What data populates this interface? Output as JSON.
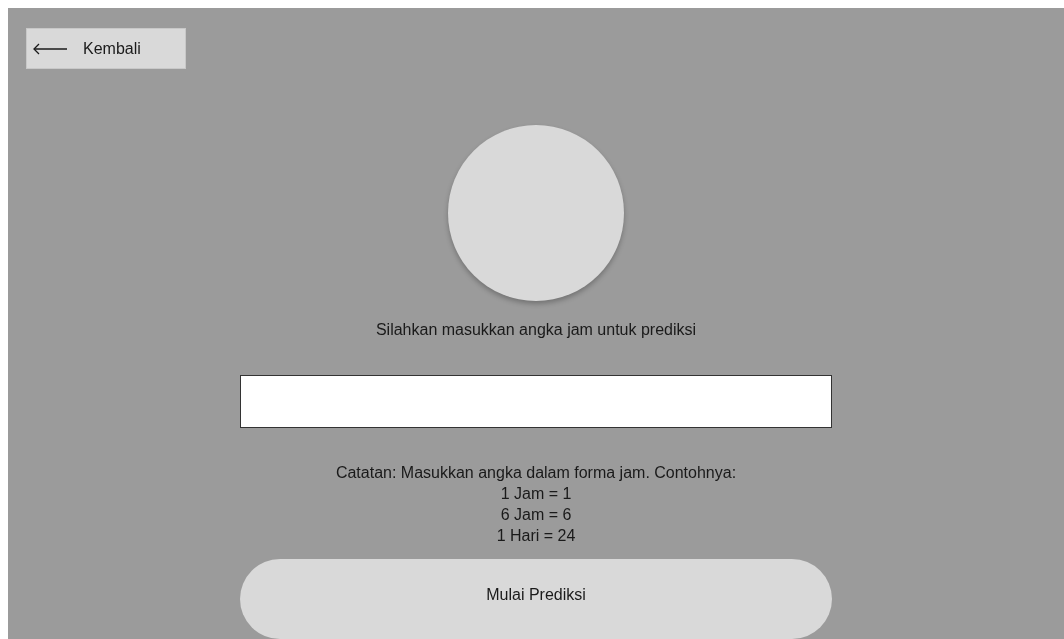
{
  "back_button": {
    "label": "Kembali"
  },
  "prompt": "Silahkan masukkan angka jam untuk prediksi",
  "note_lines": [
    "Catatan: Masukkan angka dalam forma jam. Contohnya:",
    "1 Jam = 1",
    "6 Jam = 6",
    "1 Hari = 24"
  ],
  "submit_button": {
    "label": "Mulai Prediksi"
  }
}
